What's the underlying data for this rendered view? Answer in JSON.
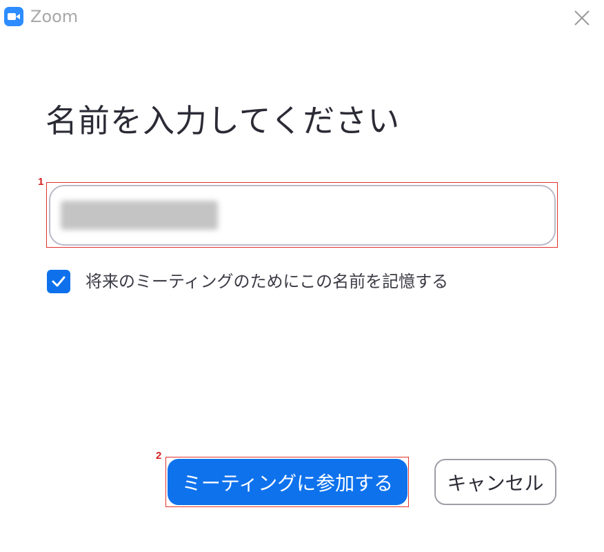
{
  "window": {
    "app_name": "Zoom",
    "app_icon": "zoom-camera-icon",
    "close_icon": "close-icon"
  },
  "dialog": {
    "heading": "名前を入力してください",
    "name_field": {
      "value": "",
      "placeholder": "",
      "blurred": true
    },
    "remember": {
      "label": "将来のミーティングのためにこの名前を記憶する",
      "checked": true
    },
    "buttons": {
      "join_label": "ミーティングに参加する",
      "cancel_label": "キャンセル"
    }
  },
  "annotations": {
    "marker_1": "1",
    "marker_2": "2"
  },
  "colors": {
    "accent": "#0e72ed",
    "annotation": "#e0302a"
  }
}
